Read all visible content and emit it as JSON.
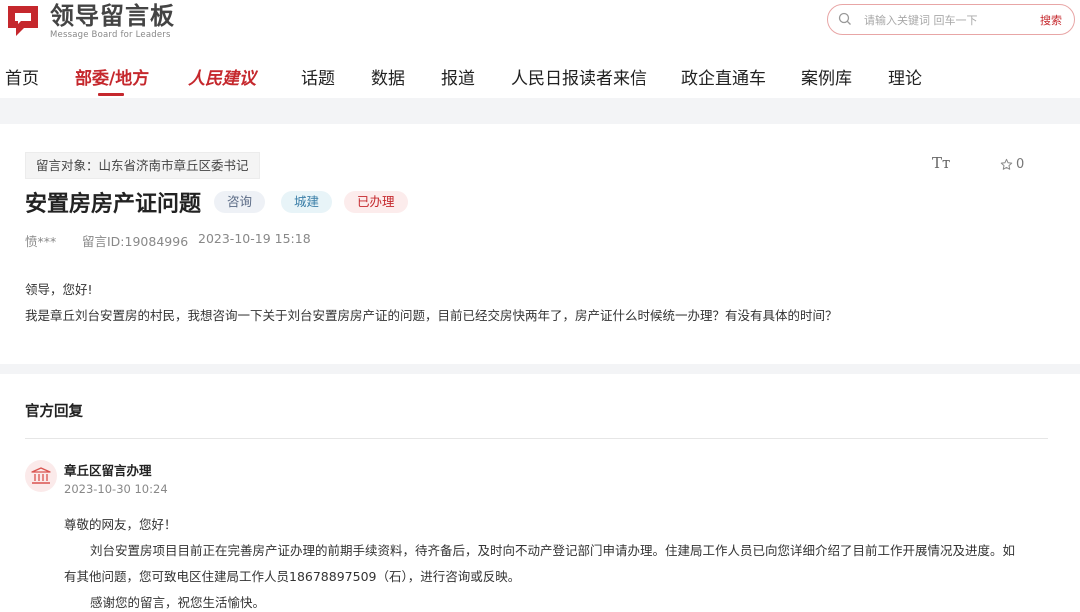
{
  "header": {
    "logo_title": "领导留言板",
    "logo_sub": "Message Board for Leaders",
    "search_placeholder": "请输入关键词 回车一下",
    "search_button": "搜索"
  },
  "nav": {
    "items": [
      "首页",
      "部委/地方",
      "人民建议",
      "话题",
      "数据",
      "报道",
      "人民日报读者来信",
      "政企直通车",
      "案例库",
      "理论"
    ],
    "active_index": 1
  },
  "message": {
    "target": "留言对象：山东省济南市章丘区委书记",
    "font_toggle": "Tт",
    "favorite_count": "0",
    "title": "安置房房产证问题",
    "tags": [
      "咨询",
      "城建",
      "已办理"
    ],
    "author": "愤***",
    "message_id": "留言ID:19084996",
    "datetime": "2023-10-19 15:18",
    "greeting": "领导，您好!",
    "content": "我是章丘刘台安置房的村民，我想咨询一下关于刘台安置房房产证的问题，目前已经交房快两年了，房产证什么时候统一办理？有没有具体的时间？"
  },
  "reply": {
    "section_title": "官方回复",
    "org_name": "章丘区留言办理",
    "org_datetime": "2023-10-30 10:24",
    "greeting": "尊敬的网友，您好！",
    "line1": "刘台安置房项目目前正在完善房产证办理的前期手续资料，待齐备后，及时向不动产登记部门申请办理。住建局工作人员已向您详细介绍了目前工作开展情况及进度。如",
    "line2": "有其他问题，您可致电区住建局工作人员18678897509（石），进行咨询或反映。",
    "line3": "感谢您的留言，祝您生活愉快。"
  },
  "colors": {
    "brand_red": "#c5282d",
    "page_bg": "#f3f4f6"
  }
}
